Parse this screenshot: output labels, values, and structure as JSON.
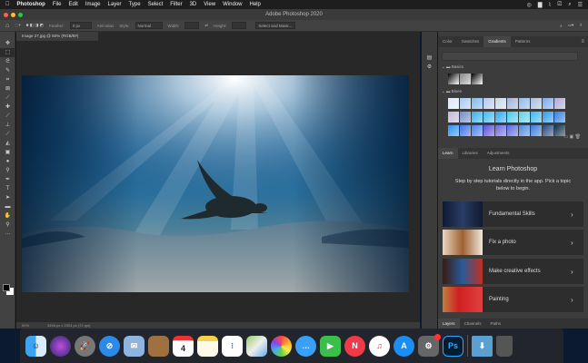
{
  "menubar": {
    "apple": "",
    "app": "Photoshop",
    "items": [
      "File",
      "Edit",
      "Image",
      "Layer",
      "Type",
      "Select",
      "Filter",
      "3D",
      "View",
      "Window",
      "Help"
    ],
    "right_icons": [
      "creative-cloud-icon",
      "display-icon",
      "wifi-icon",
      "airplay-icon",
      "search-icon",
      "control-center-icon"
    ]
  },
  "window": {
    "title": "Adobe Photoshop 2020"
  },
  "options": {
    "feather_label": "Feather:",
    "feather_value": "0 px",
    "anti_alias": "Anti-alias",
    "style_label": "Style:",
    "style_value": "Normal",
    "width_label": "Width:",
    "height_label": "Height:",
    "select_mask": "Select and Mask..."
  },
  "document": {
    "tab": "Image 27.jpg @ 50% (RGB/8#)",
    "zoom": "50%",
    "info": "3456 px x 2304 px (72 ppi)"
  },
  "tools": [
    "move",
    "marquee",
    "lasso",
    "quick-select",
    "crop",
    "frame",
    "eyedropper",
    "healing",
    "brush",
    "clone-stamp",
    "history-brush",
    "eraser",
    "gradient",
    "blur",
    "dodge",
    "pen",
    "type",
    "path-select",
    "rectangle",
    "hand",
    "zoom",
    "more"
  ],
  "gradients_panel": {
    "tabs": [
      "Color",
      "Swatches",
      "Gradients",
      "Patterns"
    ],
    "active": "Gradients",
    "groups": [
      "Basics",
      "Blues"
    ]
  },
  "learn_panel": {
    "tabs": [
      "Learn",
      "Libraries",
      "Adjustments"
    ],
    "active": "Learn",
    "title": "Learn Photoshop",
    "description": "Step by step tutorials directly in the app. Pick a topic below to begin.",
    "cards": [
      "Fundamental Skills",
      "Fix a photo",
      "Make creative effects",
      "Painting"
    ]
  },
  "layers_panel": {
    "tabs": [
      "Layers",
      "Channels",
      "Paths"
    ],
    "active": "Layers"
  },
  "dock": {
    "apps": [
      "Finder",
      "Siri",
      "Launchpad",
      "Safari",
      "Mail",
      "Contacts",
      "Calendar",
      "Notes",
      "Reminders",
      "Maps",
      "Photos",
      "Messages",
      "FaceTime",
      "News",
      "Music",
      "App Store",
      "System Preferences",
      "Photoshop",
      "Downloads",
      "Trash"
    ],
    "calendar_day": "4",
    "ps_label": "Ps"
  }
}
